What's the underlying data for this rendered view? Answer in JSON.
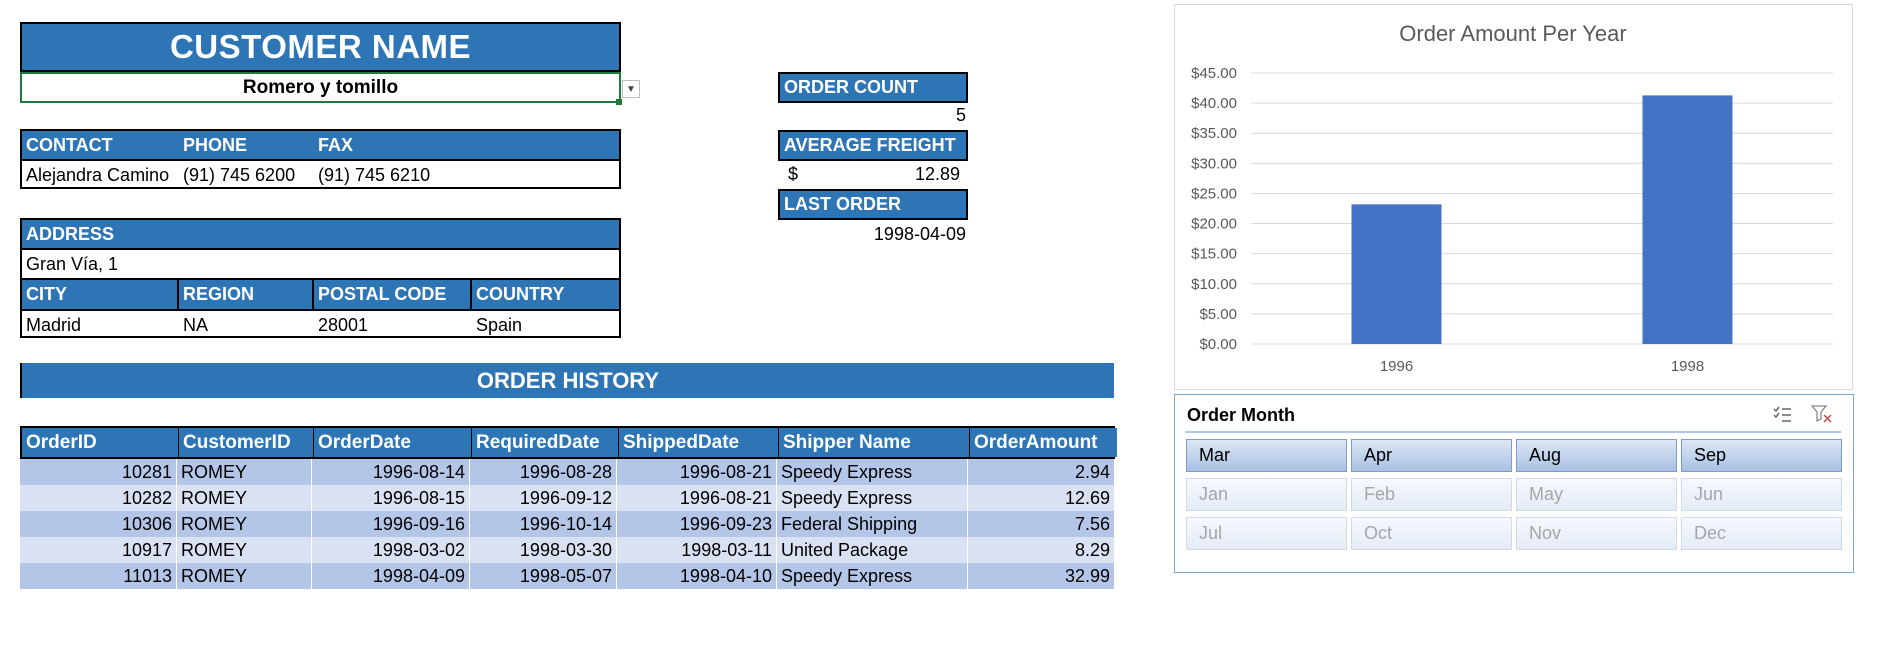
{
  "customer": {
    "title": "CUSTOMER NAME",
    "name": "Romero y tomillo",
    "dropdown_icon": "chevron-down-icon"
  },
  "contact": {
    "headers": [
      "CONTACT",
      "PHONE",
      "FAX"
    ],
    "values": [
      "Alejandra Camino",
      "(91) 745 6200",
      "(91) 745 6210"
    ]
  },
  "address": {
    "header": "ADDRESS",
    "value": "Gran Vía, 1",
    "headers": [
      "CITY",
      "REGION",
      "POSTAL CODE",
      "COUNTRY"
    ],
    "values": [
      "Madrid",
      "NA",
      "28001",
      "Spain"
    ]
  },
  "kpis": {
    "order_count_label": "ORDER COUNT",
    "order_count": "5",
    "avg_freight_label": "AVERAGE FREIGHT",
    "avg_freight_currency": "$",
    "avg_freight": "12.89",
    "last_order_label": "LAST ORDER",
    "last_order": "1998-04-09"
  },
  "order_history": {
    "title": "ORDER HISTORY",
    "columns": [
      "OrderID",
      "CustomerID",
      "OrderDate",
      "RequiredDate",
      "ShippedDate",
      "Shipper Name",
      "OrderAmount"
    ],
    "rows": [
      [
        "10281",
        "ROMEY",
        "1996-08-14",
        "1996-08-28",
        "1996-08-21",
        "Speedy Express",
        "2.94"
      ],
      [
        "10282",
        "ROMEY",
        "1996-08-15",
        "1996-09-12",
        "1996-08-21",
        "Speedy Express",
        "12.69"
      ],
      [
        "10306",
        "ROMEY",
        "1996-09-16",
        "1996-10-14",
        "1996-09-23",
        "Federal Shipping",
        "7.56"
      ],
      [
        "10917",
        "ROMEY",
        "1998-03-02",
        "1998-03-30",
        "1998-03-11",
        "United Package",
        "8.29"
      ],
      [
        "11013",
        "ROMEY",
        "1998-04-09",
        "1998-05-07",
        "1998-04-10",
        "Speedy Express",
        "32.99"
      ]
    ],
    "band_colors": [
      "#b4c6e7",
      "#d9e1f2"
    ]
  },
  "chart_data": {
    "type": "bar",
    "title": "Order Amount Per Year",
    "categories": [
      "1996",
      "1998"
    ],
    "values": [
      23.19,
      41.28
    ],
    "ylim": [
      0,
      45
    ],
    "yticks": [
      "$0.00",
      "$5.00",
      "$10.00",
      "$15.00",
      "$20.00",
      "$25.00",
      "$30.00",
      "$35.00",
      "$40.00",
      "$45.00"
    ],
    "xlabel": "",
    "ylabel": "",
    "grid": true,
    "bar_color": "#4472c4"
  },
  "slicer": {
    "title": "Order Month",
    "multiselect_icon": "multi-select-icon",
    "clear_filter_icon": "clear-filter-icon",
    "months": [
      {
        "label": "Mar",
        "selected": true
      },
      {
        "label": "Apr",
        "selected": true
      },
      {
        "label": "Aug",
        "selected": true
      },
      {
        "label": "Sep",
        "selected": true
      },
      {
        "label": "Jan",
        "selected": false
      },
      {
        "label": "Feb",
        "selected": false
      },
      {
        "label": "May",
        "selected": false
      },
      {
        "label": "Jun",
        "selected": false
      },
      {
        "label": "Jul",
        "selected": false
      },
      {
        "label": "Oct",
        "selected": false
      },
      {
        "label": "Nov",
        "selected": false
      },
      {
        "label": "Dec",
        "selected": false
      }
    ]
  },
  "colors": {
    "header_blue": "#2e75b6",
    "selection_green": "#1f7a3a"
  }
}
